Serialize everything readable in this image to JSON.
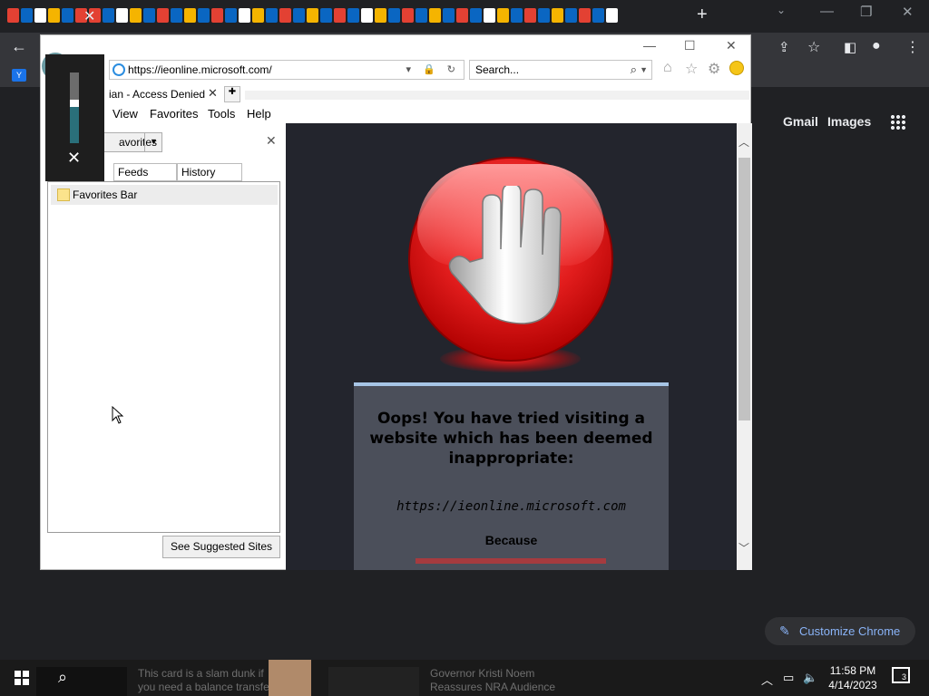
{
  "chrome": {
    "tab_close": "✕",
    "new_tab": "+",
    "window_controls": {
      "minimize": "—",
      "restore": "❐",
      "close": "✕"
    },
    "tab_icon_colors": [
      "#e34133",
      "#0a66c2",
      "#ffffff",
      "#f5b400",
      "#0a66c2",
      "#e34133",
      "#0a66c2",
      "#f5b400",
      "#0a66c2"
    ],
    "ntp": {
      "gmail": "Gmail",
      "images": "Images",
      "customize": "Customize Chrome"
    },
    "bookmark_label": "Y"
  },
  "ie": {
    "url": "https://ieonline.microsoft.com/",
    "search_placeholder": "Search...",
    "tab_title": "ian - Access Denied",
    "menu": {
      "view": "View",
      "favorites": "Favorites",
      "tools": "Tools",
      "help": "Help"
    },
    "favorites_panel": {
      "header_button": "avorites",
      "tabs": [
        "Feeds",
        "History"
      ],
      "items": [
        "Favorites Bar"
      ],
      "suggested_button": "See Suggested Sites"
    },
    "content": {
      "title": "Oops! You have tried visiting a website which has been deemed inappropriate:",
      "blocked_url": "https://ieonline.microsoft.com",
      "because": "Because"
    }
  },
  "overlay": {
    "close": "✕",
    "volume_level": 0.5
  },
  "taskbar": {
    "news1": [
      "This card is a slam dunk if",
      "you need a balance transfer"
    ],
    "news2": [
      "Governor Kristi Noem",
      "Reassures NRA Audience"
    ],
    "time": "11:58 PM",
    "date": "4/14/2023",
    "notifications": "3"
  }
}
